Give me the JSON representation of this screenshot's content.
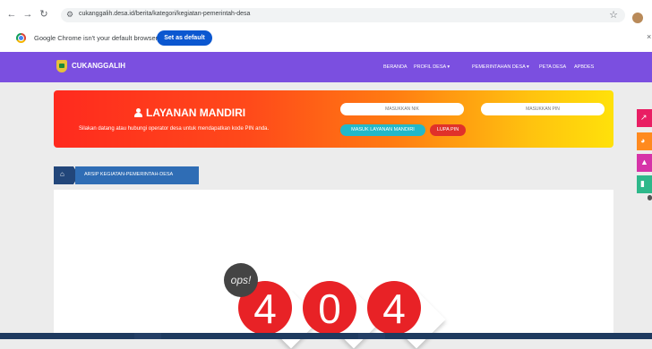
{
  "browser": {
    "url": "cukanggalih.desa.id/berita/kategori/kegiatan-pemerintah-desa",
    "banner_message": "Google Chrome isn't your default browser",
    "banner_button": "Set as default"
  },
  "site": {
    "brand": "CUKANGGALIH",
    "menu": [
      "BERANDA",
      "PROFIL DESA ▾",
      "PEMERINTAHAN DESA ▾",
      "PETA DESA",
      "APBDES"
    ]
  },
  "layanan": {
    "title": "LAYANAN MANDIRI",
    "subtitle": "Silakan datang atau hubungi operator desa untuk mendapatkan kode PIN anda.",
    "nik_placeholder": "MASUKKAN NIK",
    "pin_placeholder": "MASUKKAN PIN",
    "login_button": "MASUK LAYANAN MANDIRI",
    "forgot_button": "LUPA PIN"
  },
  "breadcrumb": {
    "current": "ARSIP KEGIATAN-PEMERINTAH-DESA"
  },
  "error": {
    "badge": "ops!",
    "digits": [
      "4",
      "0",
      "4"
    ]
  },
  "colors": {
    "navbar": "#7b4fe0",
    "accent_red": "#e82226",
    "breadcrumb": "#2f6db5"
  }
}
